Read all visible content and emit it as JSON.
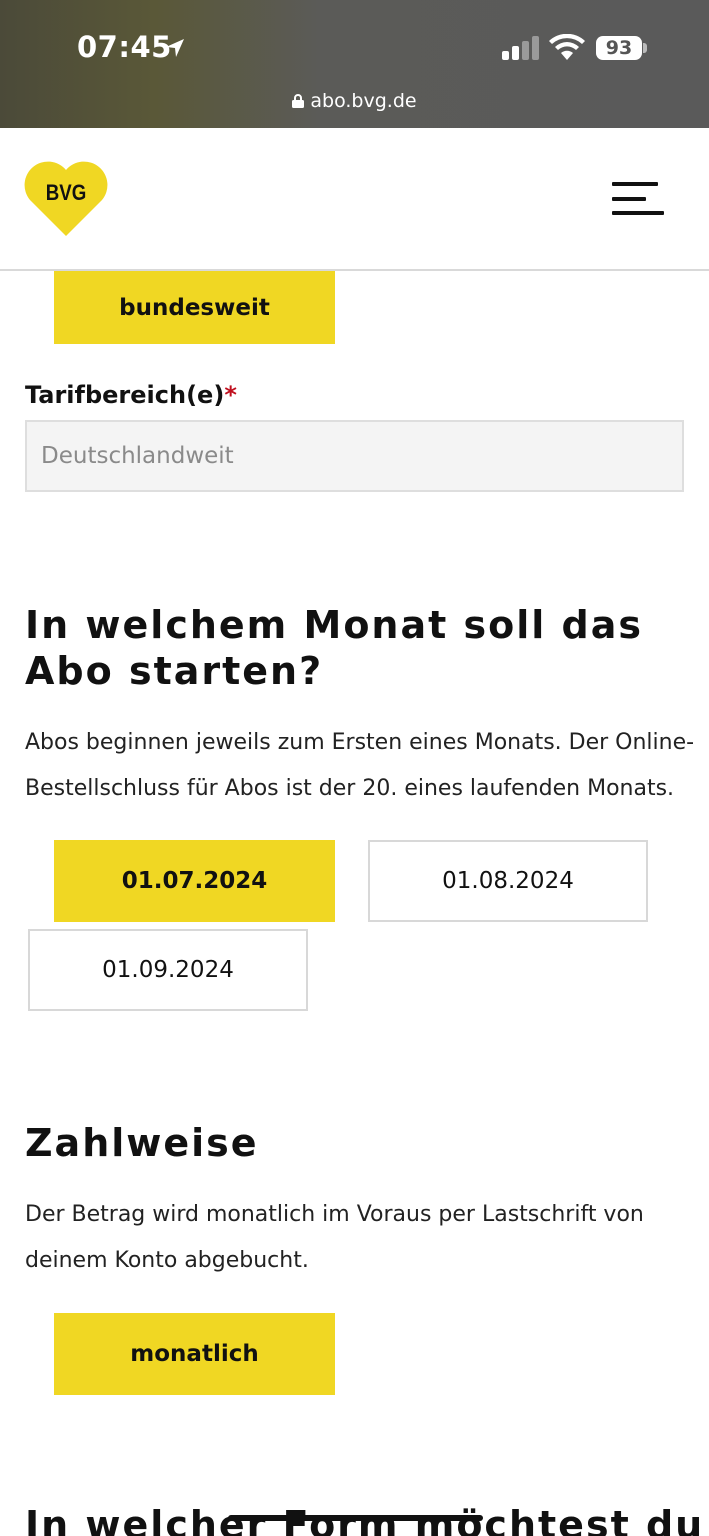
{
  "status_bar": {
    "time": "07:45",
    "battery": "93"
  },
  "browser": {
    "url": "abo.bvg.de"
  },
  "header": {
    "logo_text": "BVG",
    "logo_color": "#f0d723"
  },
  "scope": {
    "selected_label": "bundesweit"
  },
  "tarif": {
    "label": "Tarifbereich(e)",
    "required_mark": "*",
    "value": "Deutschlandweit"
  },
  "start_month": {
    "heading": "In welchem Monat soll das Abo starten?",
    "description": "Abos beginnen jeweils zum Ersten eines Monats. Der Online-Bestellschluss für Abos ist der 20. eines laufenden Monats.",
    "options": [
      {
        "label": "01.07.2024",
        "selected": true
      },
      {
        "label": "01.08.2024",
        "selected": false
      },
      {
        "label": "01.09.2024",
        "selected": false
      }
    ]
  },
  "payment": {
    "heading": "Zahlweise",
    "description": "Der Betrag wird monatlich im Voraus per Lastschrift von deinem Konto abgebucht.",
    "selected_label": "monatlich"
  },
  "next_section": {
    "heading_partial": "In welcher Form möchtest du"
  },
  "colors": {
    "accent": "#f0d723",
    "required": "#c0101f"
  }
}
